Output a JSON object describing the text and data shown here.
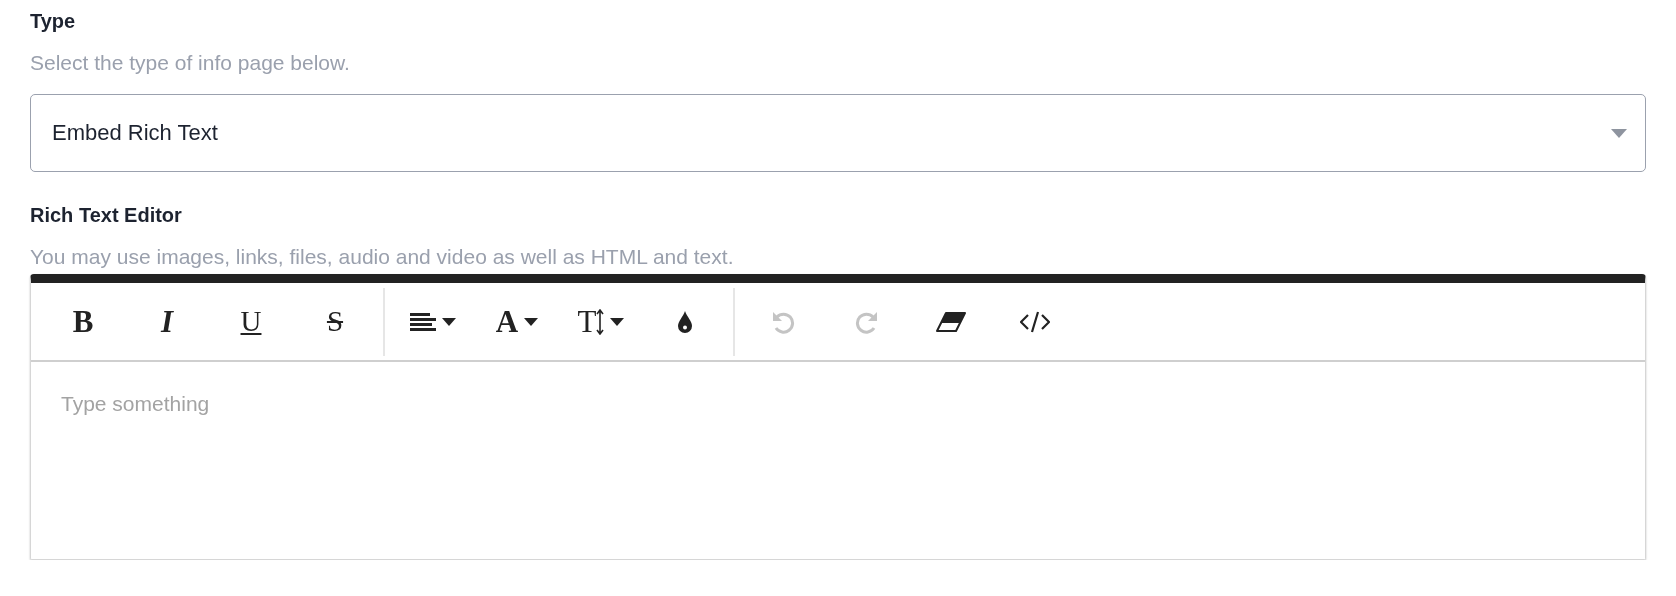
{
  "type_field": {
    "label": "Type",
    "hint": "Select the type of info page below.",
    "value": "Embed Rich Text"
  },
  "editor": {
    "label": "Rich Text Editor",
    "hint": "You may use images, links, files, audio and video as well as HTML and text.",
    "placeholder": "Type something",
    "toolbar": [
      [
        {
          "kind": "bold",
          "glyph": "B",
          "disabled": false
        },
        {
          "kind": "italic",
          "glyph": "I",
          "disabled": false
        },
        {
          "kind": "underline",
          "glyph": "U",
          "disabled": false
        },
        {
          "kind": "strike",
          "glyph": "S",
          "disabled": false
        }
      ],
      [
        {
          "kind": "align",
          "disabled": false
        },
        {
          "kind": "font",
          "glyph": "A",
          "disabled": false
        },
        {
          "kind": "size",
          "glyph": "T",
          "disabled": false
        },
        {
          "kind": "color",
          "disabled": false
        }
      ],
      [
        {
          "kind": "undo",
          "disabled": true
        },
        {
          "kind": "redo",
          "disabled": true
        },
        {
          "kind": "eraser",
          "disabled": false
        },
        {
          "kind": "code",
          "disabled": false
        }
      ]
    ]
  }
}
